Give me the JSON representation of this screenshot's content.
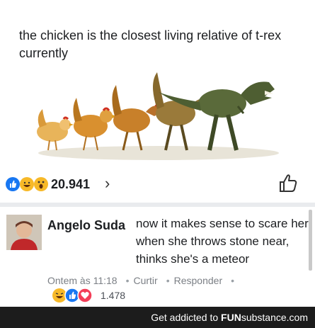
{
  "post": {
    "text": "the chicken is the closest living relative of t-rex currently"
  },
  "reactions": {
    "icons": [
      "like-icon",
      "haha-icon",
      "wow-icon"
    ],
    "count": "20.941",
    "chevron": "›"
  },
  "comment": {
    "author": "Angelo Suda",
    "text": "now it makes sense to scare her when she throws stone near, thinks she's a meteor",
    "time": "Ontem às 11:18",
    "like_label": "Curtir",
    "reply_label": "Responder",
    "reaction_count": "1.478",
    "reaction_icons": [
      "haha-icon",
      "like-icon",
      "love-icon"
    ]
  },
  "footer": {
    "prefix": "Get addicted to",
    "brand_bold": "FUN",
    "brand_rest": "substance.com"
  },
  "colors": {
    "like_blue": "#1877f2",
    "love_red": "#f33e58",
    "haha_yellow": "#f7b928",
    "footer_bg": "#1c1c1c"
  }
}
